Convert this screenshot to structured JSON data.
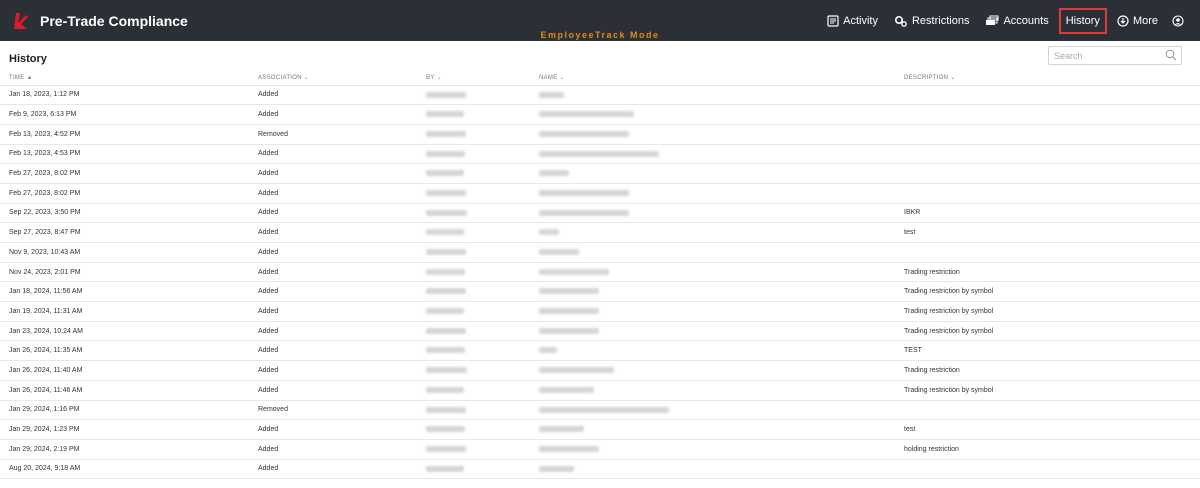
{
  "app": {
    "title": "Pre-Trade Compliance",
    "mode_label": "EmployeeTrack Mode",
    "logo_color": "#d81e2c"
  },
  "nav": {
    "activity": "Activity",
    "restrictions": "Restrictions",
    "accounts": "Accounts",
    "history": "History",
    "more": "More",
    "active_highlight_color": "#e03a3a"
  },
  "page": {
    "title": "History",
    "search_placeholder": "Search"
  },
  "table": {
    "columns": {
      "time": "TIME",
      "association": "ASSOCIATION",
      "by": "BY",
      "name": "NAME",
      "description": "DESCRIPTION"
    },
    "rows": [
      {
        "time": "Jan 18, 2023, 1:12 PM",
        "association": "Added",
        "description": ""
      },
      {
        "time": "Feb 9, 2023, 6:13 PM",
        "association": "Added",
        "description": ""
      },
      {
        "time": "Feb 13, 2023, 4:52 PM",
        "association": "Removed",
        "description": ""
      },
      {
        "time": "Feb 13, 2023, 4:53 PM",
        "association": "Added",
        "description": ""
      },
      {
        "time": "Feb 27, 2023, 8:02 PM",
        "association": "Added",
        "description": ""
      },
      {
        "time": "Feb 27, 2023, 8:02 PM",
        "association": "Added",
        "description": ""
      },
      {
        "time": "Sep 22, 2023, 3:50 PM",
        "association": "Added",
        "description": "IBKR"
      },
      {
        "time": "Sep 27, 2023, 8:47 PM",
        "association": "Added",
        "description": "test"
      },
      {
        "time": "Nov 9, 2023, 10:43 AM",
        "association": "Added",
        "description": ""
      },
      {
        "time": "Nov 24, 2023, 2:01 PM",
        "association": "Added",
        "description": "Trading restriction"
      },
      {
        "time": "Jan 18, 2024, 11:56 AM",
        "association": "Added",
        "description": "Trading restriction by symbol"
      },
      {
        "time": "Jan 19, 2024, 11:31 AM",
        "association": "Added",
        "description": "Trading restriction by symbol"
      },
      {
        "time": "Jan 23, 2024, 10:24 AM",
        "association": "Added",
        "description": "Trading restriction by symbol"
      },
      {
        "time": "Jan 26, 2024, 11:35 AM",
        "association": "Added",
        "description": "TEST"
      },
      {
        "time": "Jan 26, 2024, 11:40 AM",
        "association": "Added",
        "description": "Trading restriction"
      },
      {
        "time": "Jan 26, 2024, 11:46 AM",
        "association": "Added",
        "description": "Trading restriction by symbol"
      },
      {
        "time": "Jan 29, 2024, 1:16 PM",
        "association": "Removed",
        "description": ""
      },
      {
        "time": "Jan 29, 2024, 1:23 PM",
        "association": "Added",
        "description": "test"
      },
      {
        "time": "Jan 29, 2024, 2:19 PM",
        "association": "Added",
        "description": "holding restriction"
      },
      {
        "time": "Aug 20, 2024, 9:18 AM",
        "association": "Added",
        "description": ""
      }
    ]
  }
}
